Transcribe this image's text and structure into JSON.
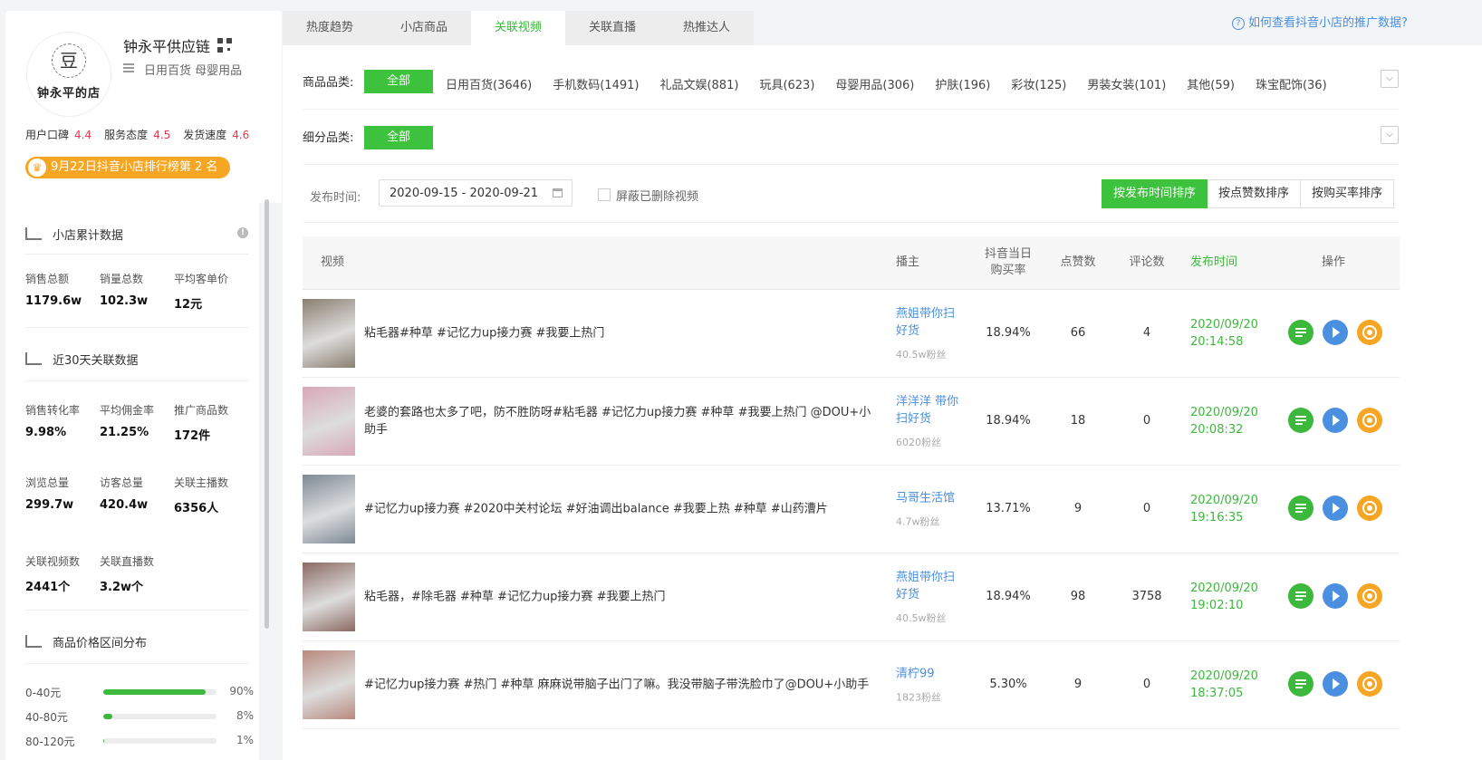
{
  "shop": {
    "logo_text": "钟永平的店",
    "name": "钟永平供应链",
    "categories": "日用百货 母婴用品",
    "scores": [
      {
        "label": "用户口碑",
        "value": "4.4"
      },
      {
        "label": "服务态度",
        "value": "4.5"
      },
      {
        "label": "发货速度",
        "value": "4.6"
      }
    ],
    "rank_badge": "9月22日抖音小店排行榜第 2 名"
  },
  "cumulative": {
    "title": "小店累计数据",
    "stats": [
      {
        "label": "销售总额",
        "value": "1179.6w"
      },
      {
        "label": "销量总数",
        "value": "102.3w"
      },
      {
        "label": "平均客单价",
        "value": "12元"
      }
    ]
  },
  "recent30": {
    "title": "近30天关联数据",
    "stats": [
      {
        "label": "销售转化率",
        "value": "9.98%"
      },
      {
        "label": "平均佣金率",
        "value": "21.25%"
      },
      {
        "label": "推广商品数",
        "value": "172件"
      },
      {
        "label": "浏览总量",
        "value": "299.7w"
      },
      {
        "label": "访客总量",
        "value": "420.4w"
      },
      {
        "label": "关联主播数",
        "value": "6356人"
      },
      {
        "label": "关联视频数",
        "value": "2441个"
      },
      {
        "label": "关联直播数",
        "value": "3.2w个"
      }
    ]
  },
  "price_dist": {
    "title": "商品价格区间分布",
    "rows": [
      {
        "label": "0-40元",
        "pct": "90%",
        "fill": 0.9
      },
      {
        "label": "40-80元",
        "pct": "8%",
        "fill": 0.08
      },
      {
        "label": "80-120元",
        "pct": "1%",
        "fill": 0.01
      }
    ]
  },
  "tabs": [
    "热度趋势",
    "小店商品",
    "关联视频",
    "关联直播",
    "热推达人"
  ],
  "help_link": "如何查看抖音小店的推广数据?",
  "filters": {
    "product_label": "商品品类:",
    "sub_label": "细分品类:",
    "all": "全部",
    "categories": [
      "日用百货(3646)",
      "手机数码(1491)",
      "礼品文娱(881)",
      "玩具(623)",
      "母婴用品(306)",
      "护肤(196)",
      "彩妆(125)",
      "男装女装(101)",
      "其他(59)",
      "珠宝配饰(36)"
    ],
    "date_label": "发布时间:",
    "date_range": "2020-09-15 - 2020-09-21",
    "hide_deleted": "屏蔽已删除视频",
    "sorts": [
      "按发布时间排序",
      "按点赞数排序",
      "按购买率排序"
    ]
  },
  "table": {
    "headers": {
      "video": "视频",
      "anchor": "播主",
      "rate_line1": "抖音当日",
      "rate_line2": "购买率",
      "likes": "点赞数",
      "comments": "评论数",
      "time": "发布时间",
      "ops": "操作"
    },
    "rows": [
      {
        "title": "粘毛器#种草 #记忆力up接力赛 #我要上热门",
        "anchor_l1": "燕姐带你扫",
        "anchor_l2": "好货",
        "fans": "40.5w粉丝",
        "rate": "18.94%",
        "likes": "66",
        "comments": "4",
        "date": "2020/09/20",
        "time": "20:14:58",
        "thumb": "#8a7f70"
      },
      {
        "title": "老婆的套路也太多了吧，防不胜防呀#粘毛器 #记忆力up接力赛 #种草 #我要上热门 @DOU+小助手",
        "anchor_l1": "洋洋洋 带你",
        "anchor_l2": "扫好货",
        "fans": "6020粉丝",
        "rate": "18.94%",
        "likes": "18",
        "comments": "0",
        "date": "2020/09/20",
        "time": "20:08:32",
        "thumb": "#d9a8b8"
      },
      {
        "title": "#记忆力up接力赛 #2020中关村论坛 #好油调出balance #我要上热 #种草 #山药漕片",
        "anchor_l1": "马哥生活馆",
        "anchor_l2": "",
        "fans": "4.7w粉丝",
        "rate": "13.71%",
        "likes": "9",
        "comments": "0",
        "date": "2020/09/20",
        "time": "19:16:35",
        "thumb": "#7d8a96"
      },
      {
        "title": "粘毛器，#除毛器 #种草 #记忆力up接力赛 #我要上热门",
        "anchor_l1": "燕姐带你扫",
        "anchor_l2": "好货",
        "fans": "40.5w粉丝",
        "rate": "18.94%",
        "likes": "98",
        "comments": "3758",
        "date": "2020/09/20",
        "time": "19:02:10",
        "thumb": "#8c6a62"
      },
      {
        "title": "#记忆力up接力赛 #热门 #种草 麻麻说带脑子出门了嘛。我没带脑子带洗脸巾了@DOU+小助手",
        "anchor_l1": "清柠99",
        "anchor_l2": "",
        "fans": "1823粉丝",
        "rate": "5.30%",
        "likes": "9",
        "comments": "0",
        "date": "2020/09/20",
        "time": "18:37:05",
        "thumb": "#b88a7e"
      }
    ]
  },
  "colors": {
    "accent": "#3cc23c",
    "link": "#4a8fe0",
    "badge": "#f6a623",
    "score": "#e8374a"
  },
  "icons": [
    "qr-code-icon",
    "list-icon",
    "crown-icon",
    "chart-icon",
    "trend-icon",
    "bar-icon",
    "info-icon",
    "help-icon",
    "chevron-down-icon",
    "calendar-icon",
    "detail-icon",
    "play-icon",
    "target-icon"
  ]
}
